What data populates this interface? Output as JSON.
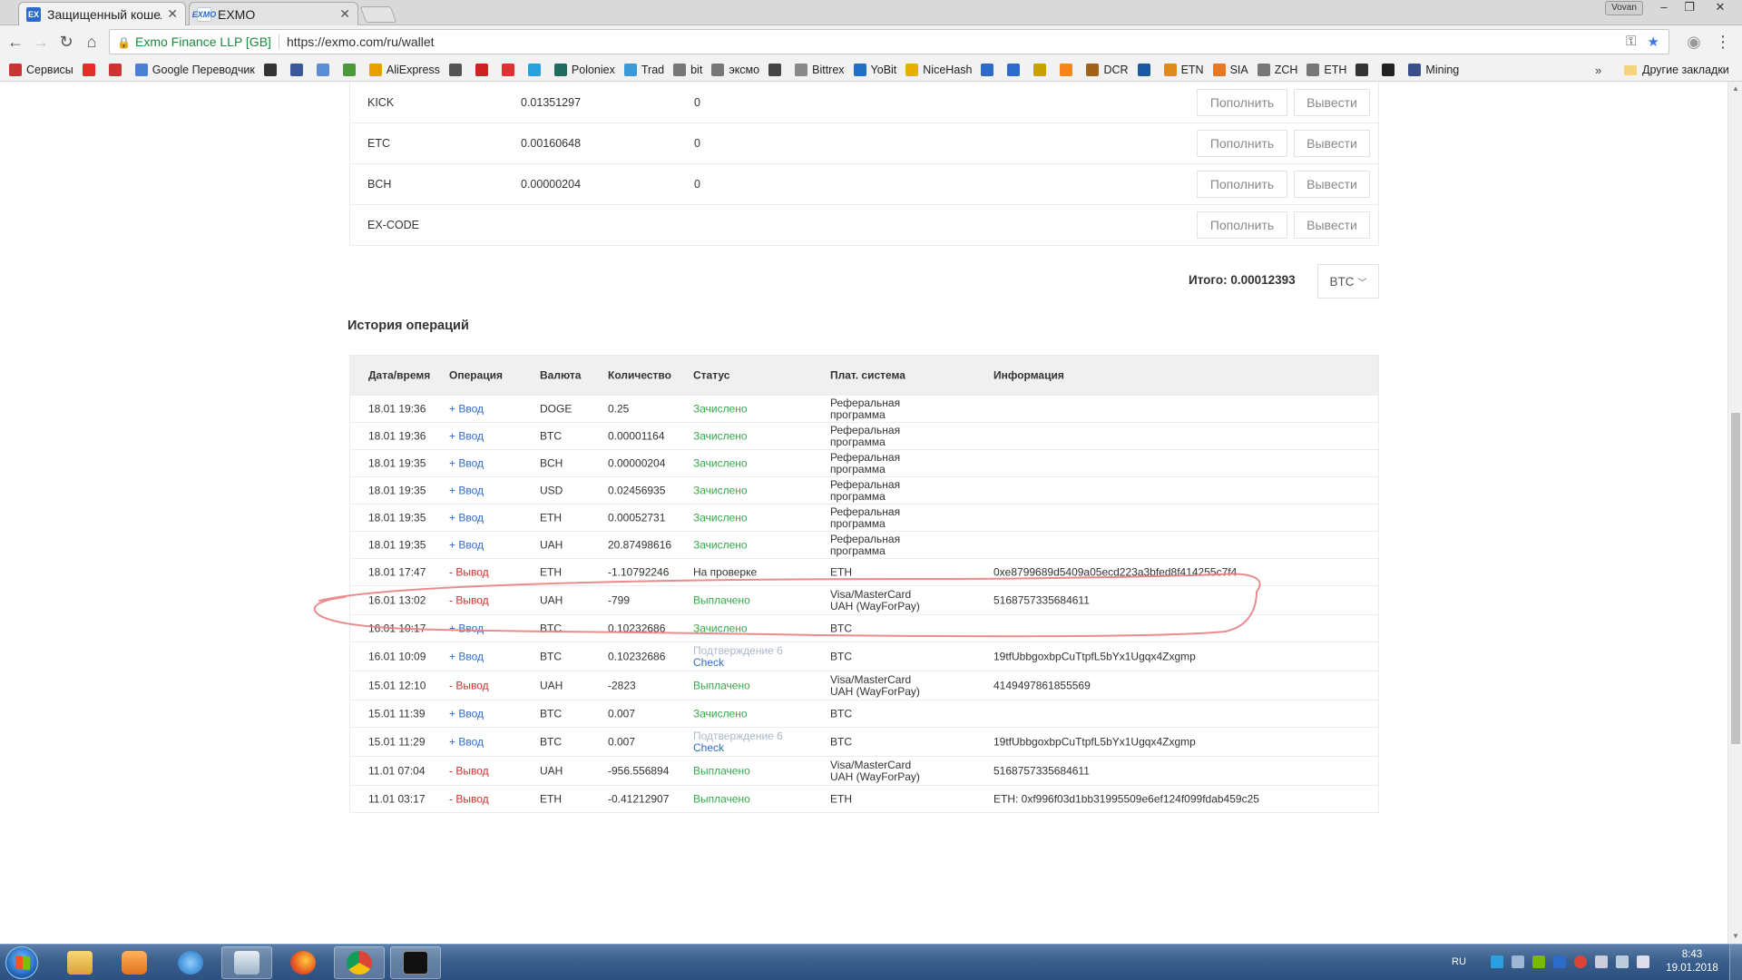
{
  "browser": {
    "tabs": [
      {
        "title": "Защищенный кошелек",
        "icon": "EX"
      },
      {
        "title": "EXMO",
        "icon": "EXMO"
      }
    ],
    "profile": "Vovan",
    "site_identity": "Exmo Finance LLP [GB]",
    "url": "https://exmo.com/ru/wallet",
    "bookmarks": [
      {
        "label": "Сервисы",
        "color": "#c33"
      },
      {
        "label": "",
        "color": "#e52d27"
      },
      {
        "label": "",
        "color": "#c33"
      },
      {
        "label": "Google Переводчик",
        "color": "#4a7fd6"
      },
      {
        "label": "",
        "color": "#333"
      },
      {
        "label": "",
        "color": "#3b5998"
      },
      {
        "label": "",
        "color": "#5b8cd6"
      },
      {
        "label": "",
        "color": "#4a9a3a"
      },
      {
        "label": "AliExpress",
        "color": "#e8a000"
      },
      {
        "label": "",
        "color": "#555"
      },
      {
        "label": "",
        "color": "#c22"
      },
      {
        "label": "",
        "color": "#d33"
      },
      {
        "label": "",
        "color": "#2aa0e0"
      },
      {
        "label": "Poloniex",
        "color": "#1f6b5c"
      },
      {
        "label": "Trad",
        "color": "#3a9ad9"
      },
      {
        "label": "bit",
        "color": "#777"
      },
      {
        "label": "эксмо",
        "color": "#777"
      },
      {
        "label": "",
        "color": "#444"
      },
      {
        "label": "Bittrex",
        "color": "#888"
      },
      {
        "label": "YoBit",
        "color": "#2170c5"
      },
      {
        "label": "NiceHash",
        "color": "#e6b000"
      },
      {
        "label": "",
        "color": "#2d6bc9"
      },
      {
        "label": "",
        "color": "#2d6bc9"
      },
      {
        "label": "",
        "color": "#c9a200"
      },
      {
        "label": "",
        "color": "#f6851b"
      },
      {
        "label": "DCR",
        "color": "#a0611a"
      },
      {
        "label": "",
        "color": "#1a5aa5"
      },
      {
        "label": "ETN",
        "color": "#e08a1e"
      },
      {
        "label": "SIA",
        "color": "#e87722"
      },
      {
        "label": "ZCH",
        "color": "#777"
      },
      {
        "label": "ETH",
        "color": "#777"
      },
      {
        "label": "",
        "color": "#333"
      },
      {
        "label": "",
        "color": "#222"
      },
      {
        "label": "Mining",
        "color": "#3a4f8a"
      }
    ],
    "bookmarks_other": "Другие закладки"
  },
  "balances": [
    {
      "currency": "KICK",
      "available": "0.01351297",
      "reserved": "0"
    },
    {
      "currency": "ETC",
      "available": "0.00160648",
      "reserved": "0"
    },
    {
      "currency": "BCH",
      "available": "0.00000204",
      "reserved": "0"
    },
    {
      "currency": "EX-CODE",
      "available": "",
      "reserved": ""
    }
  ],
  "buttons": {
    "deposit": "Пополнить",
    "withdraw": "Вывести"
  },
  "total": {
    "label": "Итого: 0.00012393",
    "currency": "BTC"
  },
  "history": {
    "title": "История операций",
    "columns": [
      "Дата/время",
      "Операция",
      "Валюта",
      "Количество",
      "Статус",
      "Плат. система",
      "Информация"
    ],
    "rows": [
      {
        "date": "18.01 19:36",
        "op": "+ Ввод",
        "dir": "in",
        "cur": "DOGE",
        "amt": "0.25",
        "status": "Зачислено",
        "st": "ok",
        "status2": "",
        "pay": "Реферальная программа",
        "info": ""
      },
      {
        "date": "18.01 19:36",
        "op": "+ Ввод",
        "dir": "in",
        "cur": "BTC",
        "amt": "0.00001164",
        "status": "Зачислено",
        "st": "ok",
        "status2": "",
        "pay": "Реферальная программа",
        "info": ""
      },
      {
        "date": "18.01 19:35",
        "op": "+ Ввод",
        "dir": "in",
        "cur": "BCH",
        "amt": "0.00000204",
        "status": "Зачислено",
        "st": "ok",
        "status2": "",
        "pay": "Реферальная программа",
        "info": ""
      },
      {
        "date": "18.01 19:35",
        "op": "+ Ввод",
        "dir": "in",
        "cur": "USD",
        "amt": "0.02456935",
        "status": "Зачислено",
        "st": "ok",
        "status2": "",
        "pay": "Реферальная программа",
        "info": ""
      },
      {
        "date": "18.01 19:35",
        "op": "+ Ввод",
        "dir": "in",
        "cur": "ETH",
        "amt": "0.00052731",
        "status": "Зачислено",
        "st": "ok",
        "status2": "",
        "pay": "Реферальная программа",
        "info": ""
      },
      {
        "date": "18.01 19:35",
        "op": "+ Ввод",
        "dir": "in",
        "cur": "UAH",
        "amt": "20.87498616",
        "status": "Зачислено",
        "st": "ok",
        "status2": "",
        "pay": "Реферальная программа",
        "info": ""
      },
      {
        "date": "18.01 17:47",
        "op": "- Вывод",
        "dir": "out",
        "cur": "ETH",
        "amt": "-1.10792246",
        "status": "На проверке",
        "st": "pend",
        "status2": "",
        "pay": "ETH",
        "info": "0xe8799689d5409a05ecd223a3bfed8f414255c7f4"
      },
      {
        "date": "16.01 13:02",
        "op": "- Вывод",
        "dir": "out",
        "cur": "UAH",
        "amt": "-799",
        "status": "Выплачено",
        "st": "ok",
        "status2": "",
        "pay": "Visa/MasterCard UAH (WayForPay)",
        "info": "5168757335684611"
      },
      {
        "date": "16.01 10:17",
        "op": "+ Ввод",
        "dir": "in",
        "cur": "BTC",
        "amt": "0.10232686",
        "status": "Зачислено",
        "st": "ok",
        "status2": "",
        "pay": "BTC",
        "info": ""
      },
      {
        "date": "16.01 10:09",
        "op": "+ Ввод",
        "dir": "in",
        "cur": "BTC",
        "amt": "0.10232686",
        "status": "Подтверждение 6",
        "st": "conf",
        "status2": "Check",
        "pay": "BTC",
        "info": "19tfUbbgoxbpCuTtpfL5bYx1Ugqx4Zxgmp"
      },
      {
        "date": "15.01 12:10",
        "op": "- Вывод",
        "dir": "out",
        "cur": "UAH",
        "amt": "-2823",
        "status": "Выплачено",
        "st": "ok",
        "status2": "",
        "pay": "Visa/MasterCard UAH (WayForPay)",
        "info": "4149497861855569"
      },
      {
        "date": "15.01 11:39",
        "op": "+ Ввод",
        "dir": "in",
        "cur": "BTC",
        "amt": "0.007",
        "status": "Зачислено",
        "st": "ok",
        "status2": "",
        "pay": "BTC",
        "info": ""
      },
      {
        "date": "15.01 11:29",
        "op": "+ Ввод",
        "dir": "in",
        "cur": "BTC",
        "amt": "0.007",
        "status": "Подтверждение 6",
        "st": "conf",
        "status2": "Check",
        "pay": "BTC",
        "info": "19tfUbbgoxbpCuTtpfL5bYx1Ugqx4Zxgmp"
      },
      {
        "date": "11.01 07:04",
        "op": "- Вывод",
        "dir": "out",
        "cur": "UAH",
        "amt": "-956.556894",
        "status": "Выплачено",
        "st": "ok",
        "status2": "",
        "pay": "Visa/MasterCard UAH (WayForPay)",
        "info": "5168757335684611"
      },
      {
        "date": "11.01 03:17",
        "op": "- Вывод",
        "dir": "out",
        "cur": "ETH",
        "amt": "-0.41212907",
        "status": "Выплачено",
        "st": "ok",
        "status2": "",
        "pay": "ETH",
        "info": "ETH: 0xf996f03d1bb31995509e6ef124f099fdab459c25"
      }
    ]
  },
  "taskbar": {
    "apps": [
      "windows-explorer",
      "media-player",
      "internet-explorer",
      "calculator",
      "firefox",
      "chrome",
      "command-prompt"
    ],
    "language": "RU",
    "time": "8:43",
    "date": "19.01.2018"
  }
}
